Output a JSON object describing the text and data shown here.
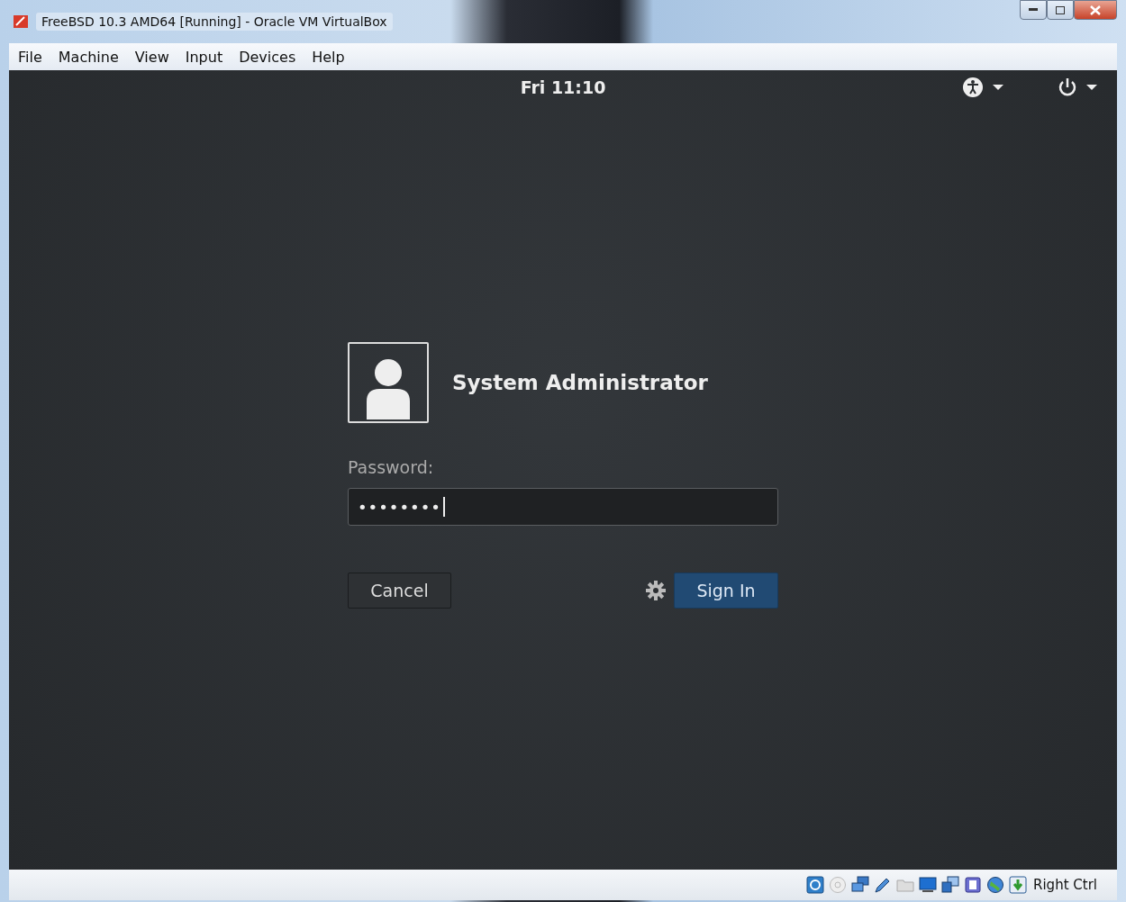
{
  "window": {
    "title": "FreeBSD 10.3 AMD64 [Running] - Oracle VM VirtualBox"
  },
  "menu": [
    "File",
    "Machine",
    "View",
    "Input",
    "Devices",
    "Help"
  ],
  "top_bar": {
    "clock": "Fri 11:10"
  },
  "login": {
    "user_name": "System Administrator",
    "password_label": "Password:",
    "password_value": "••••••••",
    "buttons": [
      {
        "label": "Cancel",
        "kind": "secondary"
      },
      {
        "label": "Sign In",
        "kind": "primary"
      }
    ]
  },
  "status_bar": {
    "host_key": "Right Ctrl"
  }
}
